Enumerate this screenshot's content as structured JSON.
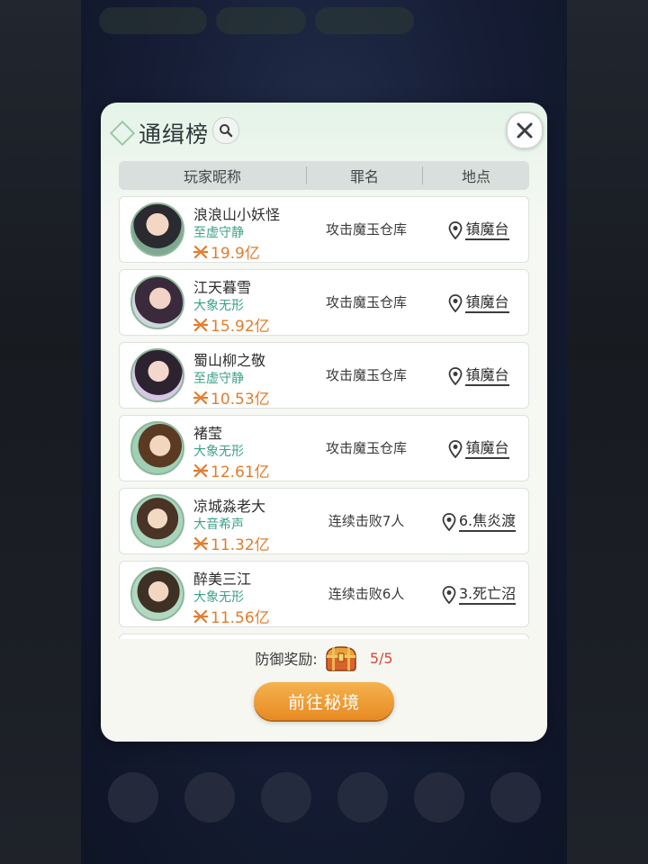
{
  "dialog": {
    "title": "通缉榜",
    "columns": [
      "玩家昵称",
      "罪名",
      "地点"
    ],
    "rows": [
      {
        "name": "浪浪山小妖怪",
        "realm": "至虚守静",
        "power": "19.9亿",
        "crime": "攻击魔玉仓库",
        "location": "镇魔台"
      },
      {
        "name": "江天暮雪",
        "realm": "大象无形",
        "power": "15.92亿",
        "crime": "攻击魔玉仓库",
        "location": "镇魔台"
      },
      {
        "name": "蜀山柳之敬",
        "realm": "至虚守静",
        "power": "10.53亿",
        "crime": "攻击魔玉仓库",
        "location": "镇魔台"
      },
      {
        "name": "褚莹",
        "realm": "大象无形",
        "power": "12.61亿",
        "crime": "攻击魔玉仓库",
        "location": "镇魔台"
      },
      {
        "name": "凉城淼老大",
        "realm": "大音希声",
        "power": "11.32亿",
        "crime": "连续击败7人",
        "location": "6.焦炎渡"
      },
      {
        "name": "醉美三江",
        "realm": "大象无形",
        "power": "11.56亿",
        "crime": "连续击败6人",
        "location": "3.死亡沼"
      }
    ],
    "reward_label": "防御奖励:",
    "reward_count": "5/5",
    "go_button": "前往秘境"
  },
  "colors": {
    "realm_text": "#3ba088",
    "power_text": "#e27c2c",
    "reward_count": "#d9483a",
    "button": "#ee9a30"
  },
  "icons": [
    "search-icon",
    "close-icon",
    "power-icon",
    "location-pin-icon",
    "treasure-chest-icon"
  ]
}
